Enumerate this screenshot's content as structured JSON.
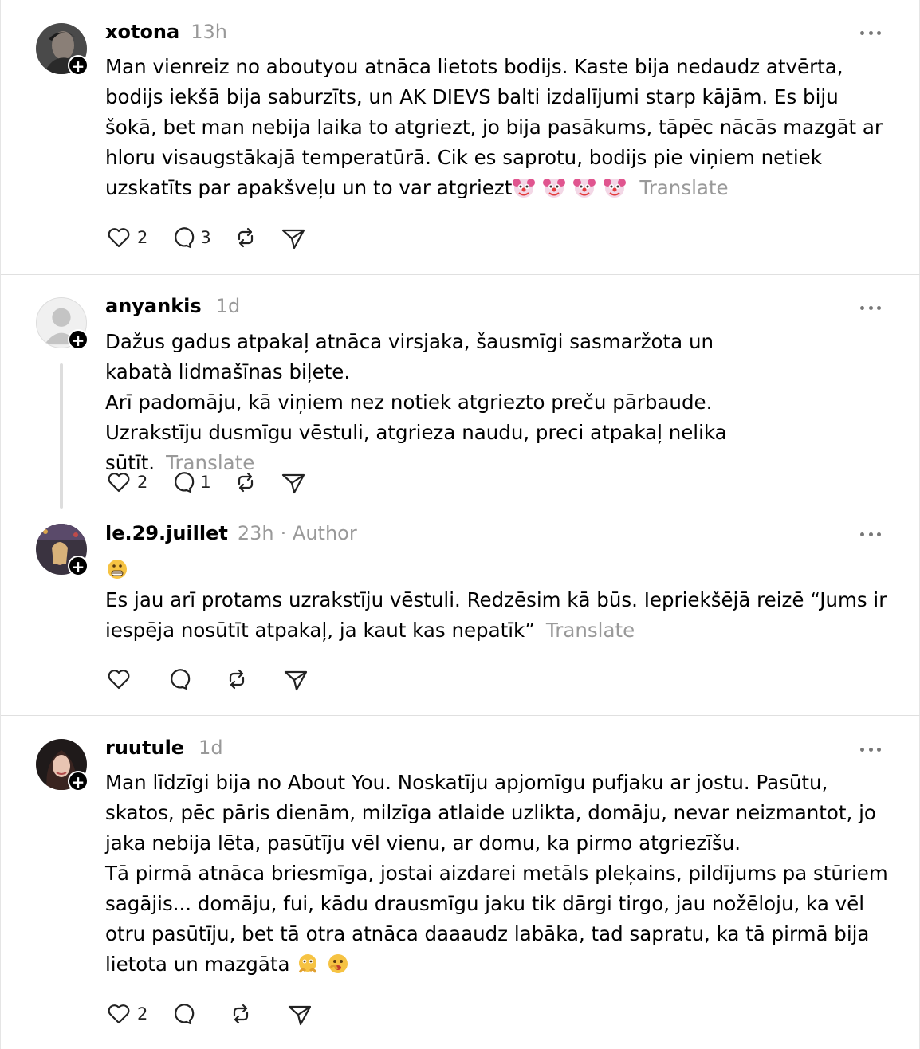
{
  "posts": [
    {
      "username": "xotona",
      "time": "13h",
      "author_tag": "",
      "text": "Man vienreiz no aboutyou atnāca lietots bodijs. Kaste bija nedaudz atvērta, bodijs iekšā bija saburzīts, un AK DIEVS balti izdalījumi starp kājām. Es biju šokā, bet man nebija laika to atgriezt, jo bija pasākums, tāpēc nācās mazgāt ar hloru visaugstākajā temperatūrā. Cik es saprotu, bodijs pie viņiem netiek uzskatīts par apakšveļu un to var atgriezt",
      "emojis": [
        "clown-face",
        "clown-face",
        "clown-face",
        "clown-face"
      ],
      "translate": "Translate",
      "likes": "2",
      "replies": "3"
    },
    {
      "username": "anyankis",
      "time": "1d",
      "author_tag": "",
      "text": "Dažus gadus atpakaļ atnāca virsjaka, šausmīgi sasmaržota un kabatà lidmašīnas biļete.\nArī padomāju, kā viņiem nez notiek atgriezto preču pārbaude.\nUzrakstīju dusmīgu vēstuli, atgrieza naudu, preci atpakaļ nelika sūtīt.",
      "translate": "Translate",
      "likes": "2",
      "replies": "1"
    },
    {
      "username": "le.29.juillet",
      "time": "23h",
      "author_tag": "· Author",
      "text": "Es jau arī protams uzrakstīju vēstuli. Redzēsim kā būs. Iepriekšējā reizē “Jums ir iespēja nosūtīt atpakaļ, ja kaut kas nepatīk”",
      "emojis": [
        "grimacing-face"
      ],
      "translate": "Translate",
      "likes": "",
      "replies": ""
    },
    {
      "username": "ruutule",
      "time": "1d",
      "author_tag": "",
      "text": "Man līdzīgi bija no About You. Noskatīju apjomīgu pufjaku ar jostu. Pasūtu, skatos, pēc pāris dienām, milzīga atlaide uzlikta, domāju, nevar neizmantot, jo jaka nebija lēta, pasūtīju vēl vienu, ar domu, ka pirmo atgriezīšu.\nTā pirmā atnāca briesmīga, jostai aizdarei metāls pleķains, pildījums pa stūriem sagājis... domāju, fui, kādu drausmīgu jaku tik dārgi tirgo, jau nožēloju, ka vēl otru pasūtīju, bet tā otra atnāca daaaudz labāka, tad sapratu, ka tā pirmā bija lietota un mazgāta",
      "emojis": [
        "face-holding-back-tears",
        "face-with-open-eyes-hand-over-mouth"
      ],
      "translate": "",
      "likes": "2",
      "replies": ""
    }
  ],
  "icons": {
    "like": "heart-icon",
    "reply": "comment-icon",
    "repost": "repost-icon",
    "share": "send-icon",
    "more": "more-icon",
    "follow": "plus-icon"
  }
}
